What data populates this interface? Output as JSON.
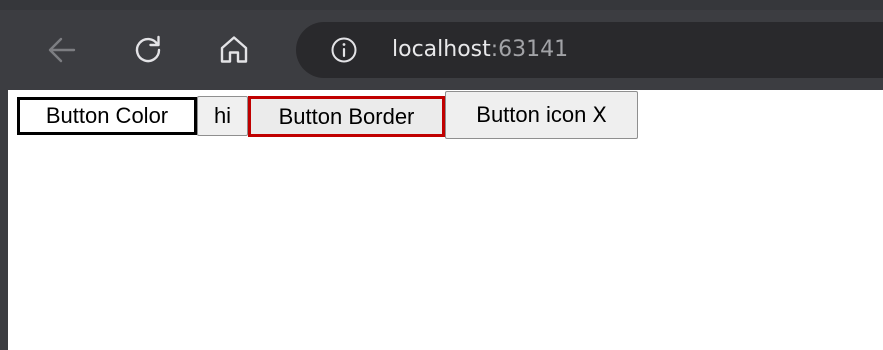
{
  "browser": {
    "url_host": "localhost",
    "url_port": ":63141",
    "icons": {
      "back": "arrow-left",
      "reload": "reload",
      "home": "home",
      "site_info": "info-circle"
    },
    "colors": {
      "toolbar": "#3c3d41",
      "address_bar": "#29292c",
      "icon_enabled": "#e3e3e6",
      "icon_disabled": "#7d7e82"
    }
  },
  "page": {
    "buttons": [
      {
        "label": "Button Color",
        "border_color": "#000000",
        "background": "#ffffff"
      },
      {
        "label": "hi"
      },
      {
        "label": "Button Border",
        "border_color": "#c00000"
      },
      {
        "label": "Button icon",
        "icon_glyph": "X"
      }
    ]
  }
}
